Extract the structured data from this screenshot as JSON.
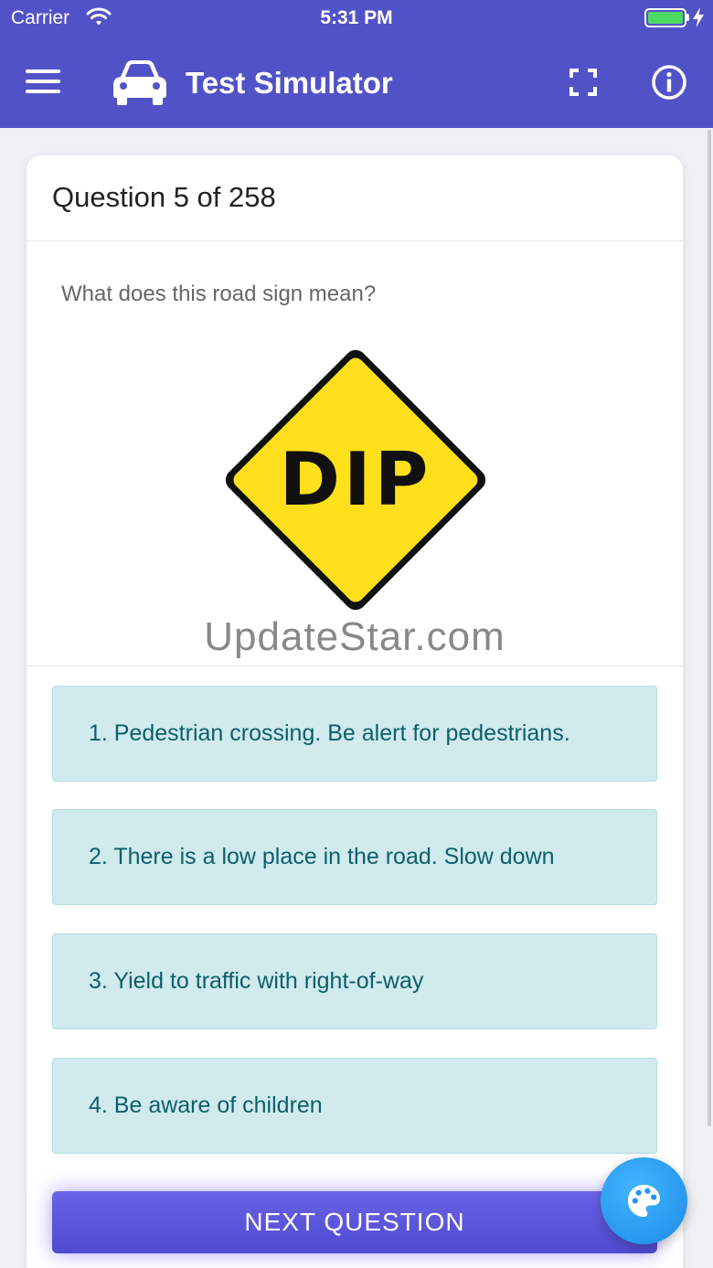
{
  "status_bar": {
    "carrier": "Carrier",
    "time": "5:31 PM"
  },
  "app_bar": {
    "title": "Test Simulator"
  },
  "question": {
    "header": "Question 5 of 258",
    "prompt": "What does this road sign mean?",
    "sign_text": "DIP",
    "watermark": "UpdateStar.com"
  },
  "answers": [
    "1. Pedestrian crossing. Be alert for pedestrians.",
    "2. There is a low place in the road. Slow down",
    "3. Yield to traffic with right-of-way",
    "4. Be aware of children"
  ],
  "next_button": {
    "label": "NEXT QUESTION"
  },
  "colors": {
    "primary": "#5252c8",
    "answer_bg": "#d0eaee",
    "answer_text": "#0c5f6b",
    "sign_yellow": "#ffe01b",
    "fab": "#2196f3"
  },
  "icons": {
    "menu": "menu-icon",
    "car": "car-icon",
    "fullscreen": "fullscreen-icon",
    "info": "info-icon",
    "palette": "palette-icon",
    "wifi": "wifi-icon",
    "battery": "battery-icon",
    "charging": "charging-bolt-icon"
  }
}
